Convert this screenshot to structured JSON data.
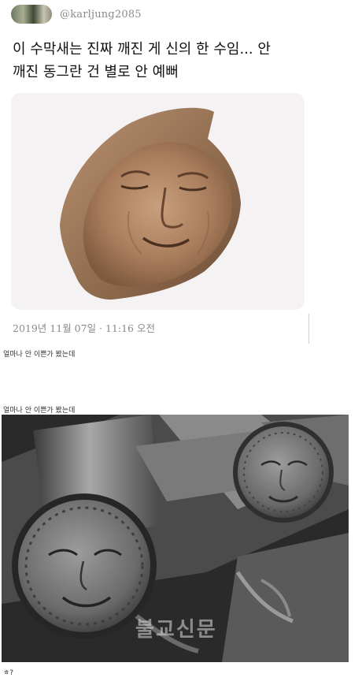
{
  "tweet": {
    "handle": "@karljung2085",
    "text_line1": "이 수막새는 진짜 깨진 게 신의 한 수임... 안",
    "text_line2": "깨진 동그란 건 별로 안 예뻐",
    "date": "2019년 11월 07일 · 11:16 오전"
  },
  "captions": {
    "first": "얼마나 안 이쁜가 봤는데",
    "second": "얼마나 안 이쁜가 봤는데",
    "third": "ㅎ?"
  },
  "photo": {
    "watermark": "불교신문"
  }
}
